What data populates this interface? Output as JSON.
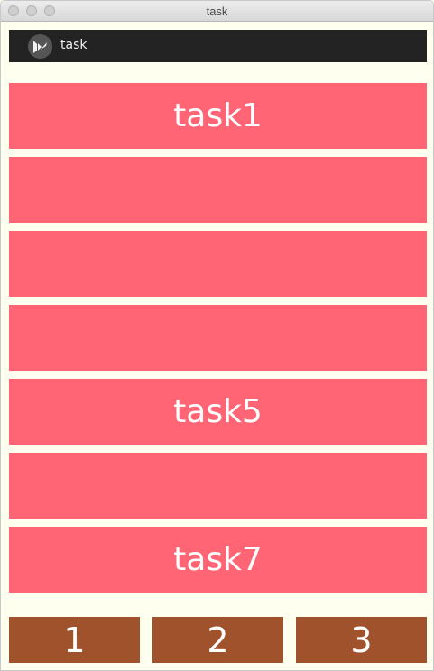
{
  "window": {
    "title": "task"
  },
  "actionbar": {
    "icon": "kivy-logo-icon",
    "title": "task"
  },
  "tasks": [
    {
      "label": "task1"
    },
    {
      "label": ""
    },
    {
      "label": ""
    },
    {
      "label": ""
    },
    {
      "label": "task5"
    },
    {
      "label": ""
    },
    {
      "label": "task7"
    }
  ],
  "bottom_buttons": [
    {
      "label": "1"
    },
    {
      "label": "2"
    },
    {
      "label": "3"
    }
  ],
  "colors": {
    "background": "#fffff0",
    "task": "#ff6574",
    "bottom_button": "#a0522d",
    "actionbar": "#232323"
  }
}
